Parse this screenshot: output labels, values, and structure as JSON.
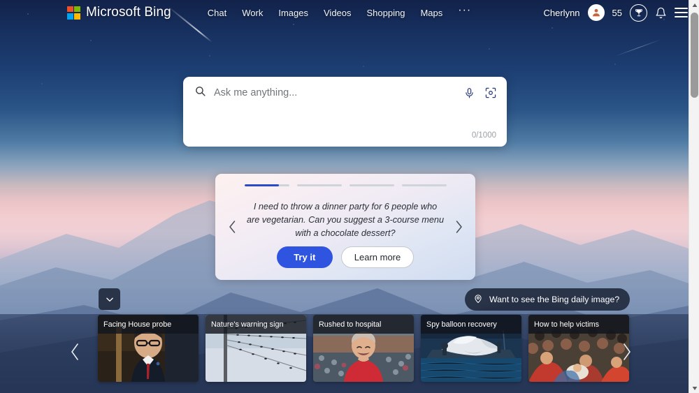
{
  "header": {
    "brand": "Microsoft Bing",
    "logo_icon": "microsoft-logo-icon",
    "nav": [
      {
        "label": "Chat"
      },
      {
        "label": "Work"
      },
      {
        "label": "Images"
      },
      {
        "label": "Videos"
      },
      {
        "label": "Shopping"
      },
      {
        "label": "Maps"
      }
    ],
    "more_label": "···",
    "username": "Cherlynn",
    "avatar_icon": "user-avatar-icon",
    "points": "55",
    "rewards_icon": "rewards-trophy-icon",
    "notifications_icon": "bell-icon",
    "menu_icon": "hamburger-menu-icon"
  },
  "search": {
    "search_icon": "search-icon",
    "placeholder": "Ask me anything...",
    "value": "",
    "mic_icon": "microphone-icon",
    "camera_icon": "visual-search-camera-icon",
    "counter": "0/1000"
  },
  "suggestion": {
    "progress": [
      {
        "filled_pct": 78
      },
      {
        "filled_pct": 0
      },
      {
        "filled_pct": 0
      },
      {
        "filled_pct": 0
      }
    ],
    "text": "I need to throw a dinner party for 6 people who are vegetarian. Can you suggest a 3-course menu with a chocolate dessert?",
    "try_label": "Try it",
    "learn_label": "Learn more",
    "prev_icon": "chevron-left-icon",
    "next_icon": "chevron-right-icon",
    "accent_color": "#2f55e0"
  },
  "daily_image_pill": {
    "icon": "location-pin-icon",
    "label": "Want to see the Bing daily image?"
  },
  "collapse_button": {
    "icon": "chevron-down-icon"
  },
  "news": {
    "prev_icon": "chevron-left-icon",
    "next_icon": "chevron-right-icon",
    "cards": [
      {
        "title": "Facing House probe"
      },
      {
        "title": "Nature's warning sign"
      },
      {
        "title": "Rushed to hospital"
      },
      {
        "title": "Spy balloon recovery"
      },
      {
        "title": "How to help victims"
      }
    ]
  },
  "scrollbar": {
    "up_icon": "scroll-up-arrow-icon",
    "down_icon": "scroll-down-arrow-icon"
  }
}
